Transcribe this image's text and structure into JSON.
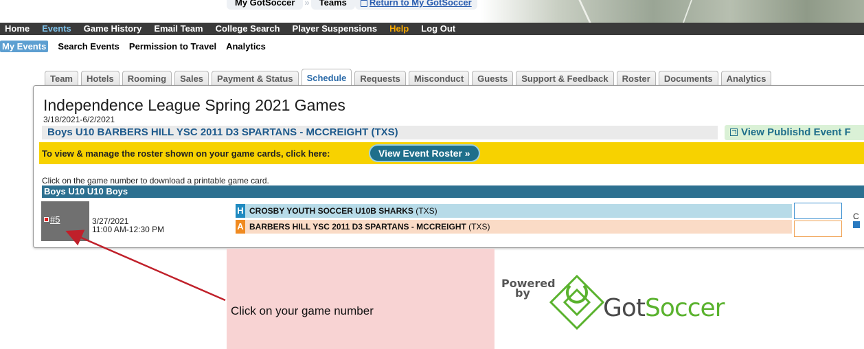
{
  "breadcrumb": {
    "item1": "My GotSoccer",
    "item2": "Teams",
    "return_link": "Return to My GotSoccer"
  },
  "main_nav": {
    "items": [
      "Home",
      "Events",
      "Game History",
      "Email Team",
      "College Search",
      "Player Suspensions",
      "Help",
      "Log Out"
    ]
  },
  "sub_nav": {
    "items": [
      "My Events",
      "Search Events",
      "Permission to Travel",
      "Analytics"
    ]
  },
  "tabs": [
    "Team",
    "Hotels",
    "Rooming",
    "Sales",
    "Payment & Status",
    "Schedule",
    "Requests",
    "Misconduct",
    "Guests",
    "Support & Feedback",
    "Roster",
    "Documents",
    "Analytics"
  ],
  "event": {
    "title": "Independence League Spring 2021 Games",
    "dates": "3/18/2021-6/2/2021",
    "team": "Boys U10 BARBERS HILL YSC 2011 D3 SPARTANS - MCCREIGHT (TXS)",
    "publish_link": "View Publishd Event F"
  },
  "roster_bar": {
    "text": "To view & manage the roster shown on your game cards, click here:",
    "button": "View Event Roster »"
  },
  "schedule": {
    "hint": "Click on the game number to download a printable game card.",
    "division": "Boys U10 U10 Boys",
    "game": {
      "number": "#5",
      "date": "3/27/2021",
      "time": "11:00 AM-12:30 PM",
      "home_badge": "H",
      "home_team": "CROSBY YOUTH SOCCER U10B SHARKS",
      "home_org": " (TXS)",
      "away_badge": "A",
      "away_team": "BARBERS HILL YSC 2011 D3 SPARTANS - MCCREIGHT",
      "away_org": " (TXS)",
      "side_letter": "C"
    }
  },
  "annotation": {
    "text": "Click on your game number"
  },
  "logo": {
    "powered_line1": "Powered",
    "powered_line2": "by",
    "brand_got": "Got",
    "brand_soccer": "Soccer"
  },
  "colors": {
    "nav_bg": "#3a3a3a",
    "active_nav": "#7ec3ec",
    "help": "#f6a800",
    "roster_bar": "#f7d200",
    "division_bar": "#2d7090",
    "home_row": "#b7dbe8",
    "away_row": "#fadbc6",
    "annotation_bg": "#f8d3d3",
    "arrow": "#c0202a",
    "brand_green": "#5ab22e"
  }
}
